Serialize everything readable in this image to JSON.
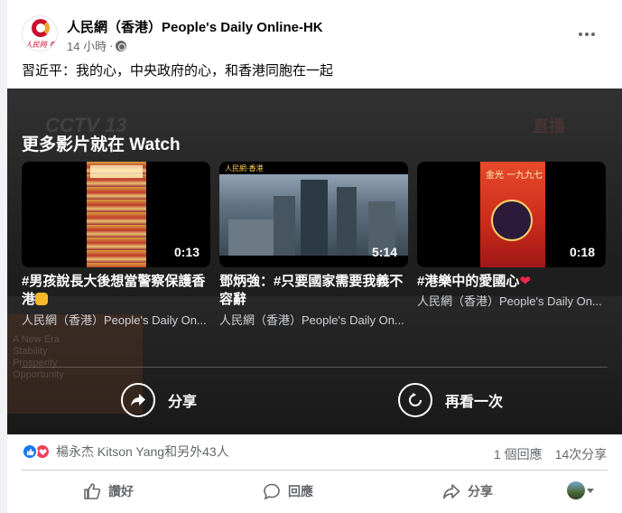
{
  "post": {
    "page_name": "人民網（香港）People's Daily Online-HK",
    "time": "14 小時",
    "dot": "·",
    "privacy_icon": "globe-icon",
    "text": "習近平：我的心，中央政府的心，和香港同胞在一起",
    "avatar_brand": "人民网 香港"
  },
  "video": {
    "watch_title": "更多影片就在 Watch",
    "bg_logo": "CCTV 13",
    "bg_live": "直播",
    "bg_banner_text": "A New Era Stability Prosperity Opportunity",
    "items": [
      {
        "title": "#男孩說長大後想當警察保護香港",
        "emoji": "flexed-biceps-icon",
        "source": "人民網（香港）People's Daily On...",
        "duration": "0:13"
      },
      {
        "title": "鄧炳強：#只要國家需要我義不容辭",
        "source": "人民網（香港）People's Daily On...",
        "duration": "5:14",
        "logo": "人民網·香港"
      },
      {
        "title": "#港樂中的愛國心",
        "emoji": "heart-icon",
        "heart": "❤",
        "source": "人民網（香港）People's Daily On...",
        "duration": "0:18",
        "art_text": "金光 一九九七"
      }
    ],
    "share_label": "分享",
    "replay_label": "再看一次"
  },
  "footer": {
    "reaction_names": "楊永杰 Kitson Yang和另外43人",
    "comments": "1 個回應",
    "shares": "14次分享",
    "actions": {
      "like": "讚好",
      "comment": "回應",
      "share": "分享"
    }
  },
  "colors": {
    "brand_blue": "#1877f2",
    "love_red": "#f33e58",
    "muted": "#65676b"
  }
}
